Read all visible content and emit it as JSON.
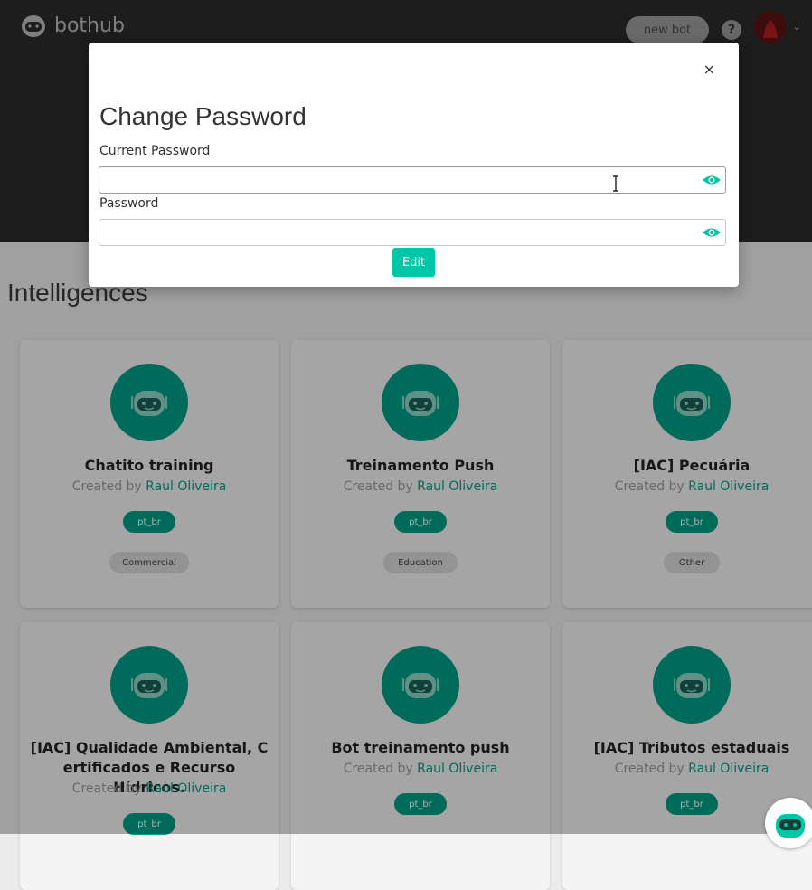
{
  "app": {
    "name": "bothub"
  },
  "header": {
    "new_bot_label": "new bot",
    "help_label": "?"
  },
  "section": {
    "title": "Intelligences"
  },
  "cards": [
    {
      "name": "Chatito training",
      "created_by": "Created by",
      "author": "Raul Oliveira",
      "language": "pt_br",
      "category": "Commercial"
    },
    {
      "name": "Treinamento Push",
      "created_by": "Created by",
      "author": "Raul Oliveira",
      "language": "pt_br",
      "category": "Education"
    },
    {
      "name": "[IAC] Pecuária",
      "created_by": "Created by",
      "author": "Raul Oliveira",
      "language": "pt_br",
      "category": "Other"
    },
    {
      "name": "[IAC] Qualidade Ambiental, C ertificados e Recurso Hídricos.",
      "created_by": "Created by",
      "author": "Raul Oliveira",
      "language": "pt_br",
      "category": ""
    },
    {
      "name": "Bot treinamento push",
      "created_by": "Created by",
      "author": "Raul Oliveira",
      "language": "pt_br",
      "category": ""
    },
    {
      "name": "[IAC] Tributos estaduais",
      "created_by": "Created by",
      "author": "Raul Oliveira",
      "language": "pt_br",
      "category": ""
    }
  ],
  "modal": {
    "title": "Change Password",
    "close_label": "×",
    "current_password_label": "Current Password",
    "current_password_value": "",
    "password_label": "Password",
    "password_value": "",
    "submit_label": "Edit"
  },
  "colors": {
    "accent": "#00c6a8",
    "brand_dark": "#009e85",
    "topbar": "#2c2c2c"
  }
}
